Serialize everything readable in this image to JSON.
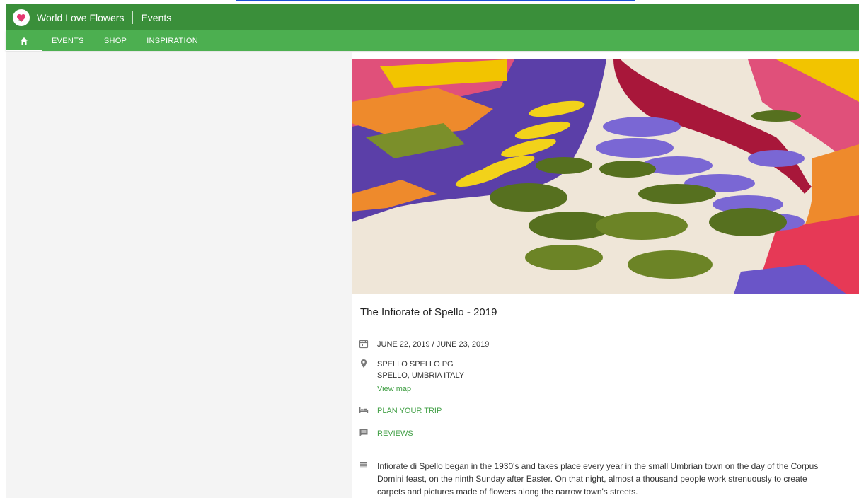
{
  "app": {
    "title": "World Love Flowers",
    "section": "Events"
  },
  "nav": {
    "items": [
      "EVENTS",
      "SHOP",
      "INSPIRATION"
    ]
  },
  "event": {
    "title": "The Infiorate of Spello - 2019",
    "dates": "JUNE 22, 2019 / JUNE 23, 2019",
    "location_line1": "SPELLO SPELLO PG",
    "location_line2": "SPELLO, UMBRIA ITALY",
    "view_map": "View map",
    "plan_trip": "PLAN YOUR TRIP",
    "reviews": "REVIEWS",
    "description": "Infiorate di Spello began in the 1930's and takes place every year in the small Umbrian town on the day of the Corpus Domini feast, on the ninth Sunday after Easter.  On that night, almost a thousand people work strenuously  to create carpets and pictures made of flowers along the narrow town's streets."
  },
  "icons": {
    "home": "home-icon",
    "calendar": "calendar-icon",
    "location": "location-pin-icon",
    "hotel": "hotel-bed-icon",
    "reviews": "comment-icon",
    "description": "notes-lines-icon"
  },
  "colors": {
    "appbar": "#3a8f3a",
    "navbar": "#4caf50",
    "link": "#43a047"
  }
}
